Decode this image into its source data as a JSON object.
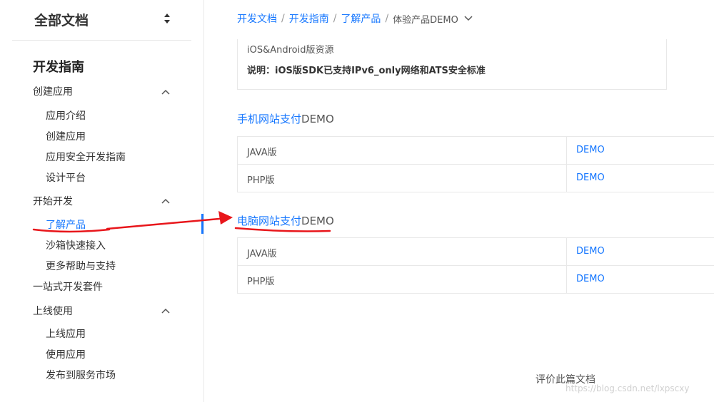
{
  "sidebar": {
    "header_title": "全部文档",
    "section_title": "开发指南",
    "groups": [
      {
        "label": "创建应用",
        "items": [
          "应用介绍",
          "创建应用",
          "应用安全开发指南",
          "设计平台"
        ]
      },
      {
        "label": "开始开发",
        "items": [
          "了解产品",
          "沙箱快速接入",
          "更多帮助与支持"
        ]
      },
      {
        "label": "一站式开发套件"
      },
      {
        "label": "上线使用",
        "items": [
          "上线应用",
          "使用应用",
          "发布到服务市场"
        ]
      }
    ],
    "active_item": "了解产品"
  },
  "breadcrumb": {
    "items": [
      "开发文档",
      "开发指南",
      "了解产品"
    ],
    "current": "体验产品DEMO",
    "separator": "/"
  },
  "resources": {
    "line1": "iOS&Android版资源",
    "line2": "说明：iOS版SDK已支持IPv6_only网络和ATS安全标准"
  },
  "sections": [
    {
      "title_link": "手机网站支付",
      "title_rest": "DEMO",
      "rows": [
        {
          "name": "JAVA版",
          "link": "DEMO"
        },
        {
          "name": "PHP版",
          "link": "DEMO"
        }
      ]
    },
    {
      "title_link": "电脑网站支付",
      "title_rest": "DEMO",
      "rows": [
        {
          "name": "JAVA版",
          "link": "DEMO"
        },
        {
          "name": "PHP版",
          "link": "DEMO"
        }
      ]
    }
  ],
  "footer": {
    "evaluate_label": "评价此篇文档",
    "watermark": "https://blog.csdn.net/lxpscxy"
  },
  "colors": {
    "link": "#1677ff",
    "annotation": "#e8161b"
  }
}
